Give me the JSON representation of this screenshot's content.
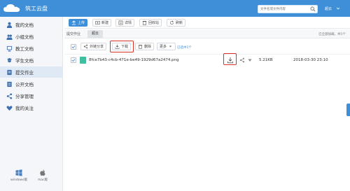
{
  "header": {
    "app_title": "筑工云盘",
    "search_placeholder": "文件名或文件内容",
    "user_name": "超云"
  },
  "sidebar": {
    "items": [
      {
        "label": "我的文档",
        "icon": "person-icon"
      },
      {
        "label": "小组文档",
        "icon": "group-icon"
      },
      {
        "label": "教工文档",
        "icon": "teacher-icon"
      },
      {
        "label": "学生文档",
        "icon": "student-icon"
      },
      {
        "label": "提交作业",
        "icon": "submit-icon"
      },
      {
        "label": "公开文档",
        "icon": "public-doc-icon"
      },
      {
        "label": "分享管理",
        "icon": "share-manage-icon"
      },
      {
        "label": "我的关注",
        "icon": "heart-icon"
      }
    ],
    "active_index": 4,
    "clients": [
      {
        "label": "windows版",
        "icon": "windows-icon"
      },
      {
        "label": "mac版",
        "icon": "apple-icon"
      }
    ]
  },
  "toolbar": {
    "upload": "上传",
    "new": "新建",
    "details": "详情",
    "recycle": "回收站",
    "refresh": "刷新"
  },
  "breadcrumb": {
    "root": "提交作业",
    "current": "超云",
    "loaded_text": "已全部加载，共1个"
  },
  "actions": {
    "external_share": "外链分享",
    "download": "下载",
    "delete": "删除",
    "more": "更多",
    "selected_count": "已选中1个"
  },
  "file": {
    "name": "8fce7b43-c4cb-471e-be49-1929d67a2474.png",
    "size": "5.21KB",
    "date": "2018-03-30 23:10"
  },
  "colors": {
    "accent": "#3e8fd8",
    "highlight_box": "#d9302c",
    "file_icon": "#3fbfa0"
  }
}
